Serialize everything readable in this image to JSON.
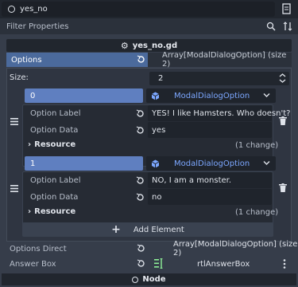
{
  "header": {
    "node_name": "yes_no",
    "filter_placeholder": "Filter Properties"
  },
  "script_header": {
    "title": "yes_no.gd"
  },
  "options": {
    "label": "Options",
    "value": "Array[ModalDialogOption] (size 2)",
    "size_label": "Size:",
    "size_value": "2",
    "items": [
      {
        "index": "0",
        "type": "ModalDialogOption",
        "option_label_name": "Option Label",
        "option_label_value": "YES! I like Hamsters. Who doesn't?",
        "option_data_name": "Option Data",
        "option_data_value": "yes",
        "resource_label": "Resource",
        "resource_changes": "(1 change)"
      },
      {
        "index": "1",
        "type": "ModalDialogOption",
        "option_label_name": "Option Label",
        "option_label_value": "NO, I am a monster.",
        "option_data_name": "Option Data",
        "option_data_value": "no",
        "resource_label": "Resource",
        "resource_changes": "(1 change)"
      }
    ],
    "add_element": "Add Element"
  },
  "options_direct": {
    "label": "Options Direct",
    "value": "Array[ModalDialogOption] (size 2)"
  },
  "answer_box": {
    "label": "Answer Box",
    "value": "rtlAnswerBox"
  },
  "node_section": {
    "label": "Node"
  },
  "colors": {
    "accent": "#4b6a9c",
    "index_field": "#5f7fc0",
    "resource_text": "#7ca7ff"
  },
  "icons": [
    "circle-node-icon",
    "doc-icon",
    "search-icon",
    "sort-icon",
    "gear-icon",
    "revert-icon",
    "stepper-icon",
    "drag-handle-icon",
    "cube-icon",
    "chevron-down-icon",
    "chevron-right-icon",
    "trash-icon",
    "plus-icon",
    "node-path-icon",
    "more-vert-icon"
  ]
}
